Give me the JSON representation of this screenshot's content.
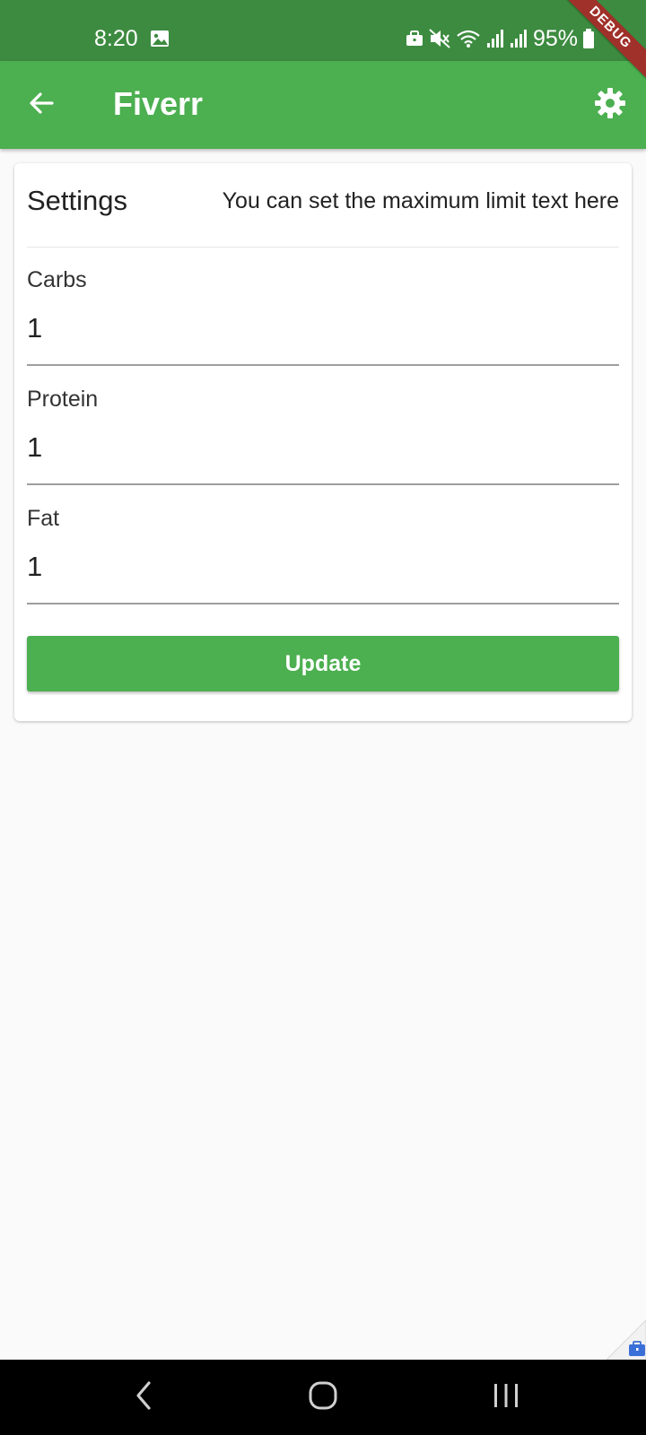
{
  "status_bar": {
    "time": "8:20",
    "battery": "95%",
    "icons": [
      "gallery-icon",
      "briefcase-icon",
      "mute-icon",
      "wifi-icon",
      "signal-icon",
      "signal-icon",
      "battery-icon"
    ]
  },
  "debug_banner": {
    "label": "DEBUG"
  },
  "app_bar": {
    "title": "Fiverr",
    "back_icon": "arrow-left-icon",
    "settings_icon": "gear-icon"
  },
  "settings": {
    "title": "Settings",
    "hint": "You can set the maximum limit text here",
    "fields": [
      {
        "label": "Carbs",
        "value": "1"
      },
      {
        "label": "Protein",
        "value": "1"
      },
      {
        "label": "Fat",
        "value": "1"
      }
    ],
    "update_label": "Update"
  },
  "nav_bar": {
    "buttons": [
      "back-icon",
      "home-icon",
      "recents-icon"
    ]
  },
  "colors": {
    "status_bar": "#3d8b40",
    "app_bar": "#4caf50",
    "button": "#4caf50",
    "background": "#fafafa",
    "debug": "#a0302a"
  }
}
